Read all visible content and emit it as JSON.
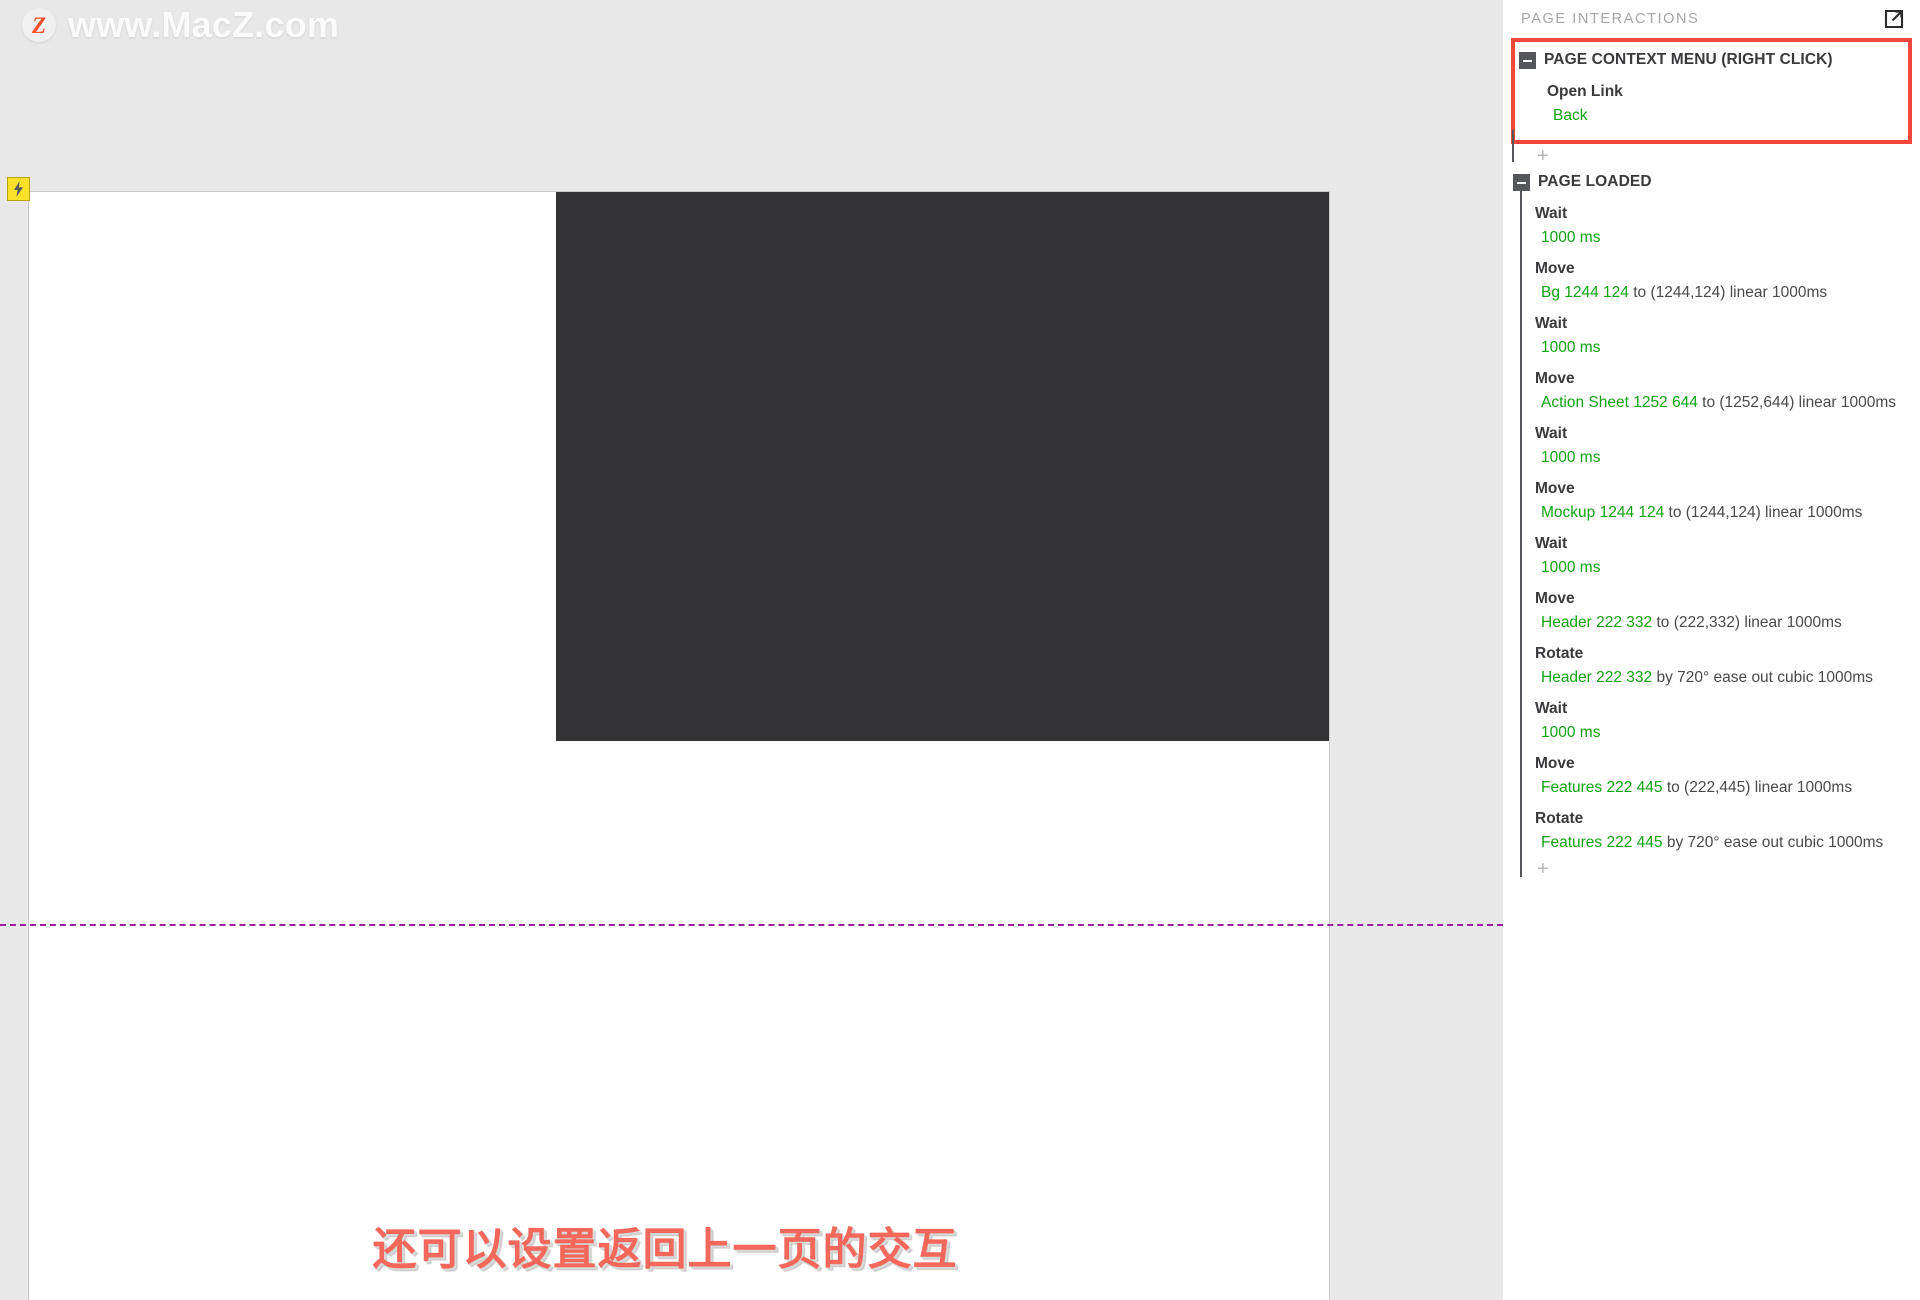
{
  "watermark": {
    "logo_letter": "Z",
    "text": "www.MacZ.com"
  },
  "canvas": {
    "caption": "还可以设置返回上一页的交互",
    "interaction_badge_icon": "lightning-bolt-icon",
    "guide_color": "#9b1f9b",
    "artboard_bg": "#ffffff",
    "artboard_dark_block": "#333335"
  },
  "panel": {
    "title": "PAGE INTERACTIONS",
    "external_link_icon": "external-link-icon",
    "accent_highlight": "#f4473c",
    "target_color": "#12a312",
    "add_label": "+"
  },
  "context_menu_event": {
    "title": "PAGE CONTEXT MENU (RIGHT CLICK)",
    "action_label": "Open Link",
    "action_target": "Back"
  },
  "page_loaded_event": {
    "title": "PAGE LOADED",
    "actions": [
      {
        "label": "Wait",
        "target": "1000 ms",
        "rest": ""
      },
      {
        "label": "Move",
        "target": "Bg 1244 124",
        "rest": " to (1244,124) linear 1000ms"
      },
      {
        "label": "Wait",
        "target": "1000 ms",
        "rest": ""
      },
      {
        "label": "Move",
        "target": "Action Sheet 1252 644",
        "rest": " to (1252,644) linear 1000ms"
      },
      {
        "label": "Wait",
        "target": "1000 ms",
        "rest": ""
      },
      {
        "label": "Move",
        "target": "Mockup 1244 124",
        "rest": " to (1244,124) linear 1000ms"
      },
      {
        "label": "Wait",
        "target": "1000 ms",
        "rest": ""
      },
      {
        "label": "Move",
        "target": "Header 222 332",
        "rest": " to (222,332) linear 1000ms"
      },
      {
        "label": "Rotate",
        "target": "Header 222 332",
        "rest": " by 720° ease out cubic 1000ms"
      },
      {
        "label": "Wait",
        "target": "1000 ms",
        "rest": ""
      },
      {
        "label": "Move",
        "target": "Features 222 445",
        "rest": " to (222,445) linear 1000ms"
      },
      {
        "label": "Rotate",
        "target": "Features 222 445",
        "rest": " by 720° ease out cubic 1000ms"
      }
    ]
  }
}
